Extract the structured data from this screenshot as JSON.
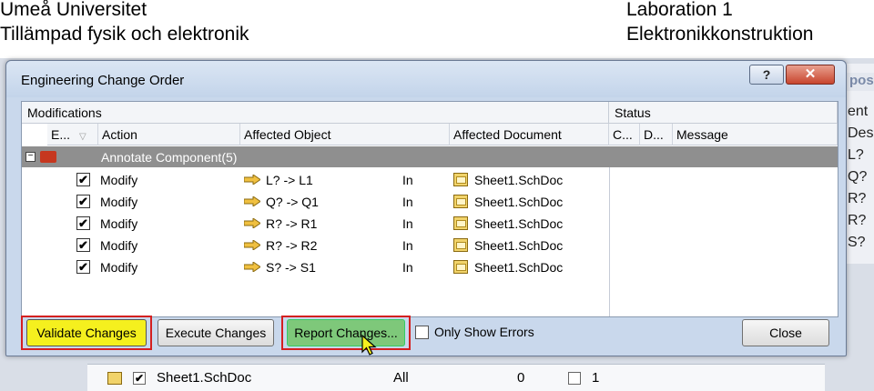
{
  "header": {
    "left_line1": "Umeå Universitet",
    "left_line2": "Tillämpad fysik och elektronik",
    "right_line1": "Laboration 1",
    "right_line2": "Elektronikkonstruktion"
  },
  "dialog": {
    "title": "Engineering Change Order",
    "help_label": "?",
    "close_x_label": "✕",
    "groups": {
      "modifications": "Modifications",
      "status": "Status"
    },
    "columns": {
      "enable": "E...",
      "action": "Action",
      "affected_object": "Affected Object",
      "affected_document": "Affected Document",
      "check": "C...",
      "done": "D...",
      "message": "Message"
    },
    "group_row": {
      "label": "Annotate Component(5)",
      "expander": "−"
    },
    "rows": [
      {
        "checked": "✔",
        "action": "Modify",
        "object": "L? -> L1",
        "in": "In",
        "document": "Sheet1.SchDoc"
      },
      {
        "checked": "✔",
        "action": "Modify",
        "object": "Q? -> Q1",
        "in": "In",
        "document": "Sheet1.SchDoc"
      },
      {
        "checked": "✔",
        "action": "Modify",
        "object": "R? -> R1",
        "in": "In",
        "document": "Sheet1.SchDoc"
      },
      {
        "checked": "✔",
        "action": "Modify",
        "object": "R? -> R2",
        "in": "In",
        "document": "Sheet1.SchDoc"
      },
      {
        "checked": "✔",
        "action": "Modify",
        "object": "S? -> S1",
        "in": "In",
        "document": "Sheet1.SchDoc"
      }
    ],
    "buttons": {
      "validate": "Validate Changes",
      "execute": "Execute Changes",
      "report": "Report Changes...",
      "only_show_errors": "Only Show Errors",
      "close": "Close"
    }
  },
  "background": {
    "right_header": "pos",
    "right_col1": "ent",
    "right_col2": "Desi",
    "right_items": [
      "L?",
      "Q?",
      "R?",
      "R?",
      "S?"
    ],
    "bottom_row": {
      "document": "Sheet1.SchDoc",
      "scope": "All",
      "count": "0",
      "value": "1"
    }
  },
  "colors": {
    "validate_highlight": "#f5f01e",
    "report_highlight": "#7ec87a",
    "annotation_border": "#d42020",
    "group_row": "#8f8f8f"
  }
}
